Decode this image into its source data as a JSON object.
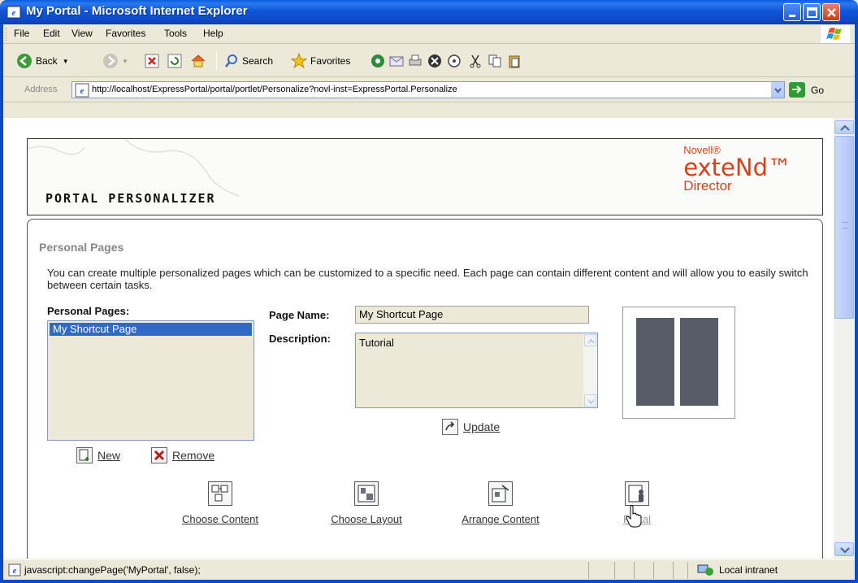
{
  "window": {
    "title": "My Portal - Microsoft Internet Explorer"
  },
  "menu": [
    "File",
    "Edit",
    "View",
    "Favorites",
    "Tools",
    "Help"
  ],
  "toolbar": {
    "back": "Back",
    "search": "Search",
    "favorites": "Favorites"
  },
  "address": {
    "label": "Address",
    "url": "http://localhost/ExpressPortal/portal/portlet/Personalize?novl-inst=ExpressPortal.Personalize",
    "go": "Go"
  },
  "header": {
    "title": "PORTAL PERSONALIZER",
    "brand_top": "Novell®",
    "brand_main": "exteNd™",
    "brand_sub": "Director"
  },
  "section": {
    "title": "Personal Pages",
    "intro": "You can create multiple personalized pages which can be customized to a specific need. Each page can contain different content and will allow you to easily switch between certain tasks.",
    "list_label": "Personal Pages:",
    "list_items": [
      "My Shortcut Page"
    ],
    "page_name_label": "Page Name:",
    "page_name_value": "My Shortcut Page",
    "description_label": "Description:",
    "description_value": "Tutorial",
    "update": "Update",
    "new": "New",
    "remove": "Remove"
  },
  "tools": [
    "Choose Content",
    "Choose Layout",
    "Arrange Content",
    "Portal"
  ],
  "status": {
    "text": "javascript:changePage('MyPortal', false);",
    "zone": "Local intranet"
  }
}
